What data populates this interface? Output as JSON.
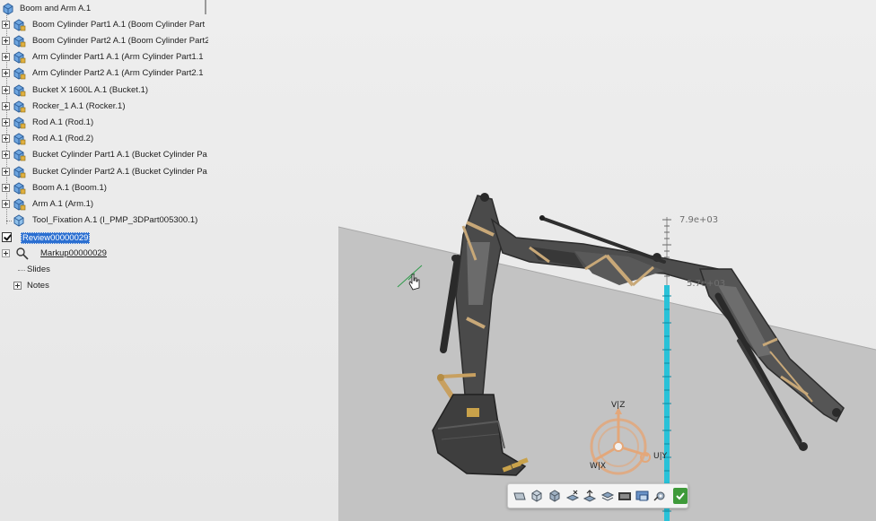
{
  "tree": {
    "root_label": "Boom and Arm A.1",
    "items": [
      {
        "label": "Boom Cylinder Part1 A.1 (Boom Cylinder Part",
        "expandable": true
      },
      {
        "label": "Boom Cylinder Part2 A.1 (Boom Cylinder Part2",
        "expandable": true
      },
      {
        "label": "Arm Cylinder Part1 A.1 (Arm Cylinder Part1.1",
        "expandable": true
      },
      {
        "label": "Arm Cylinder Part2 A.1 (Arm Cylinder Part2.1",
        "expandable": true
      },
      {
        "label": "Bucket X 1600L A.1 (Bucket.1)",
        "expandable": true
      },
      {
        "label": "Rocker_1 A.1 (Rocker.1)",
        "expandable": true
      },
      {
        "label": "Rod A.1 (Rod.1)",
        "expandable": true
      },
      {
        "label": "Rod A.1 (Rod.2)",
        "expandable": true
      },
      {
        "label": "Bucket Cylinder Part1 A.1 (Bucket Cylinder Pa",
        "expandable": true
      },
      {
        "label": "Bucket Cylinder Part2 A.1 (Bucket Cylinder Pa",
        "expandable": true
      },
      {
        "label": "Boom A.1 (Boom.1)",
        "expandable": true
      },
      {
        "label": "Arm A.1 (Arm.1)",
        "expandable": true
      },
      {
        "label": "Tool_Fixation A.1 (I_PMP_3DPart005300.1)",
        "expandable": false
      }
    ],
    "review_label": "Review00000029",
    "markup_label": "Markup00000029",
    "slides_label": "Slides",
    "notes_label": "Notes"
  },
  "viewport": {
    "ruler_top_value": "7.9e+03",
    "ruler_mid_value": "5.7e+03",
    "accent_cyan": "#29c2d8",
    "floor_color": "#c2c2c2"
  },
  "compass": {
    "axis_top": "V|Z",
    "axis_right": "U|Y",
    "axis_left": "W|X",
    "color": "#e3a77a"
  },
  "toolbar": {
    "icons": [
      "plane-view-icon",
      "box-view-icon",
      "box-view-2-icon",
      "sectioning-icon",
      "cursor-up-icon",
      "layers-icon",
      "film-icon",
      "monitor-icon",
      "settings-gear-icon"
    ],
    "ok_icon": "check-icon",
    "ok_color": "#3f9a3a"
  }
}
